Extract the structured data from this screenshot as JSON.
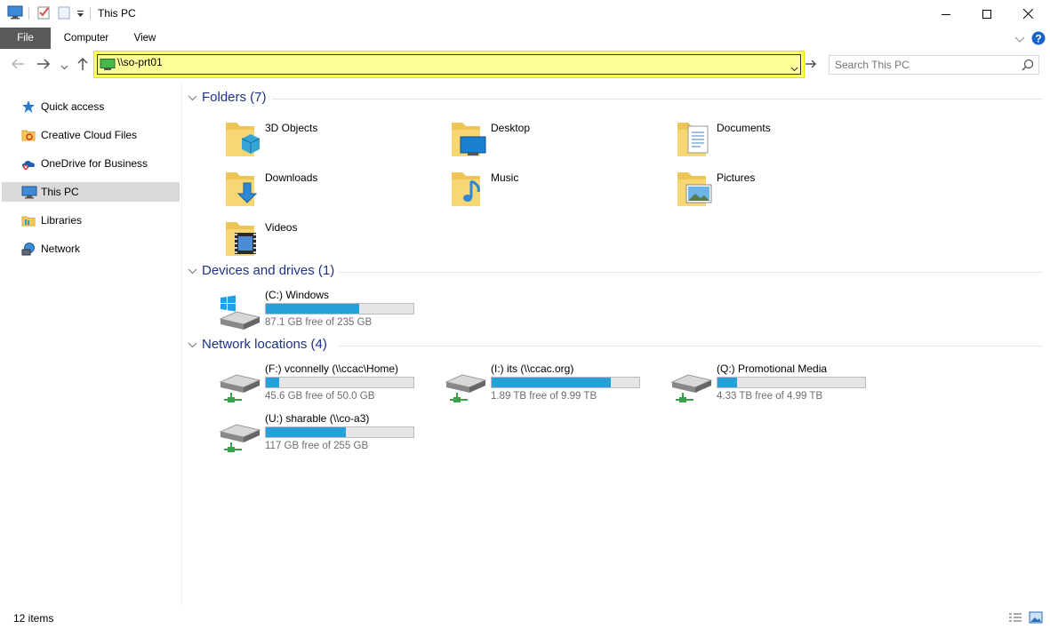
{
  "window": {
    "title": "This PC"
  },
  "ribbon": {
    "tabs": [
      {
        "label": "File"
      },
      {
        "label": "Computer"
      },
      {
        "label": "View"
      }
    ]
  },
  "address": {
    "value": "\\\\so-prt01"
  },
  "search": {
    "placeholder": "Search This PC"
  },
  "sidebar": {
    "items": [
      {
        "label": "Quick access",
        "icon": "star-icon"
      },
      {
        "label": "Creative Cloud Files",
        "icon": "creative-cloud-folder-icon"
      },
      {
        "label": "OneDrive for Business",
        "icon": "onedrive-icon"
      },
      {
        "label": "This PC",
        "icon": "computer-icon",
        "selected": true
      },
      {
        "label": "Libraries",
        "icon": "libraries-icon"
      },
      {
        "label": "Network",
        "icon": "network-icon"
      }
    ]
  },
  "groups": {
    "folders": {
      "title": "Folders (7)"
    },
    "devices": {
      "title": "Devices and drives (1)"
    },
    "network": {
      "title": "Network locations (4)"
    }
  },
  "folders": [
    {
      "label": "3D Objects",
      "icon": "3d-objects-folder-icon"
    },
    {
      "label": "Desktop",
      "icon": "desktop-folder-icon"
    },
    {
      "label": "Documents",
      "icon": "documents-folder-icon"
    },
    {
      "label": "Downloads",
      "icon": "downloads-folder-icon"
    },
    {
      "label": "Music",
      "icon": "music-folder-icon"
    },
    {
      "label": "Pictures",
      "icon": "pictures-folder-icon"
    },
    {
      "label": "Videos",
      "icon": "videos-folder-icon"
    }
  ],
  "drives": [
    {
      "label": "(C:) Windows",
      "free": "87.1 GB free of 235 GB",
      "used_fraction": 0.63,
      "icon": "windows-drive-icon"
    }
  ],
  "network_drives": [
    {
      "label": "(F:) vconnelly (\\\\ccac\\Home)",
      "free": "45.6 GB free of 50.0 GB",
      "used_fraction": 0.09,
      "icon": "network-drive-icon"
    },
    {
      "label": "(I:) its (\\\\ccac.org)",
      "free": "1.89 TB free of 9.99 TB",
      "used_fraction": 0.81,
      "icon": "network-drive-icon"
    },
    {
      "label": "(Q:) Promotional Media",
      "free": "4.33 TB free of 4.99 TB",
      "used_fraction": 0.13,
      "icon": "network-drive-icon"
    },
    {
      "label": "(U:) sharable (\\\\co-a3)",
      "free": "117 GB free of 255 GB",
      "used_fraction": 0.54,
      "icon": "network-drive-icon"
    }
  ],
  "status": {
    "count": "12 items"
  },
  "colors": {
    "accent": "#26a0da",
    "group_header": "#1e3287",
    "address_highlight": "#ffff66"
  }
}
